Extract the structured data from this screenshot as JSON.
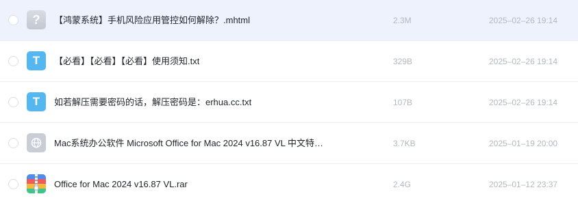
{
  "files": [
    {
      "icon": "unknown-file-icon",
      "icon_glyph": "?",
      "name": "【鸿蒙系统】手机风险应用管控如何解除？.mhtml",
      "size": "2.3M",
      "date": "2025–02–26 19:14"
    },
    {
      "icon": "text-file-icon",
      "icon_glyph": "T",
      "name": "【必看】【必看】【必看】使用须知.txt",
      "size": "329B",
      "date": "2025–02–26 19:14"
    },
    {
      "icon": "text-file-icon",
      "icon_glyph": "T",
      "name": "如若解压需要密码的话，解压密码是：erhua.cc.txt",
      "size": "107B",
      "date": "2025–02–26 19:14"
    },
    {
      "icon": "web-file-icon",
      "name": "Mac系统办公软件 Microsoft Office for Mac 2024 v16.87 VL 中文特…",
      "size": "3.7KB",
      "date": "2025–01–19 20:00"
    },
    {
      "icon": "archive-file-icon",
      "name": "Office for Mac 2024 v16.87 VL.rar",
      "size": "2.4G",
      "date": "2025–01–12 23:37"
    }
  ],
  "colors": {
    "selected_row": "#eef2fd",
    "text_icon": "#55b7f0",
    "meta_text": "#b4b8c0"
  }
}
